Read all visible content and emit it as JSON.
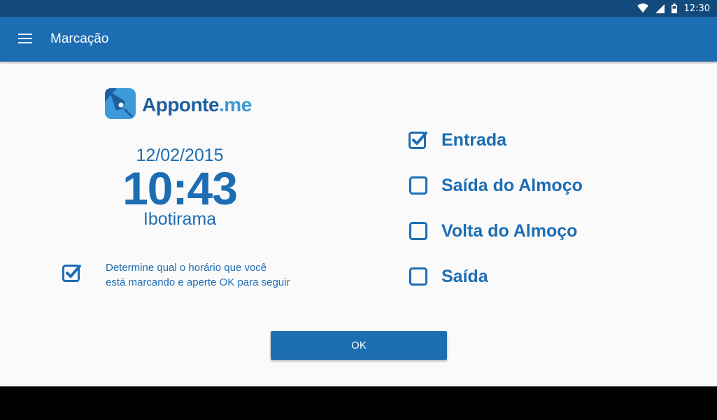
{
  "status_bar": {
    "time": "12:30",
    "icons": [
      "wifi-icon",
      "signal-icon",
      "battery-icon"
    ]
  },
  "app_bar": {
    "title": "Marcação",
    "menu_icon": "menu-icon"
  },
  "logo": {
    "brand": "Apponte",
    "suffix": ".me"
  },
  "clock": {
    "date": "12/02/2015",
    "time": "10:43",
    "city": "Ibotirama"
  },
  "hint": {
    "checked": true,
    "line1": "Determine qual o horário que você",
    "line2": "está marcando e aperte OK para seguir"
  },
  "options": [
    {
      "label": "Entrada",
      "checked": true
    },
    {
      "label": "Saída do Almoço",
      "checked": false
    },
    {
      "label": "Volta do Almoço",
      "checked": false
    },
    {
      "label": "Saída",
      "checked": false
    }
  ],
  "ok_button": {
    "label": "OK"
  },
  "colors": {
    "primary": "#1d6db3",
    "status_bar": "#134a7c",
    "background": "#fafafa",
    "logo_dark": "#1c5f9e",
    "logo_light": "#3c9ad9"
  }
}
